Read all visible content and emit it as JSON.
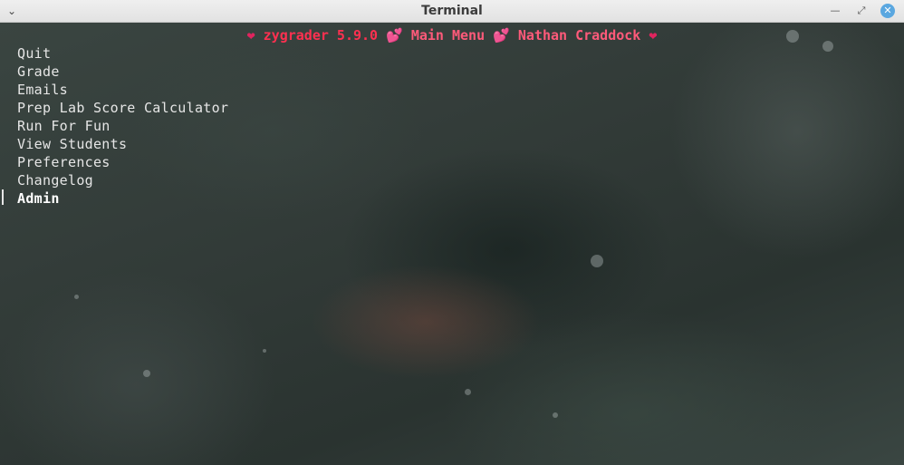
{
  "window": {
    "title": "Terminal",
    "menu_icon": "chevron-down-icon",
    "minimize_label": "⌄",
    "maximize_label": "⤢",
    "close_label": "✕"
  },
  "header": {
    "heart_left": "❤",
    "app_name": "zygrader 5.9.0",
    "heart_mid1": "💕",
    "menu_name": "Main Menu",
    "heart_mid2": "💕",
    "user_name": "Nathan Craddock",
    "heart_right": "❤"
  },
  "menu": {
    "items": [
      {
        "label": "Quit"
      },
      {
        "label": "Grade"
      },
      {
        "label": "Emails"
      },
      {
        "label": "Prep Lab Score Calculator"
      },
      {
        "label": "Run For Fun"
      },
      {
        "label": "View Students"
      },
      {
        "label": "Preferences"
      },
      {
        "label": "Changelog"
      },
      {
        "label": "Admin"
      }
    ],
    "selected_index": 8
  },
  "colors": {
    "heart": "#e0245e",
    "header_text": "#ff3050",
    "menu_text": "#e6e6e6"
  }
}
